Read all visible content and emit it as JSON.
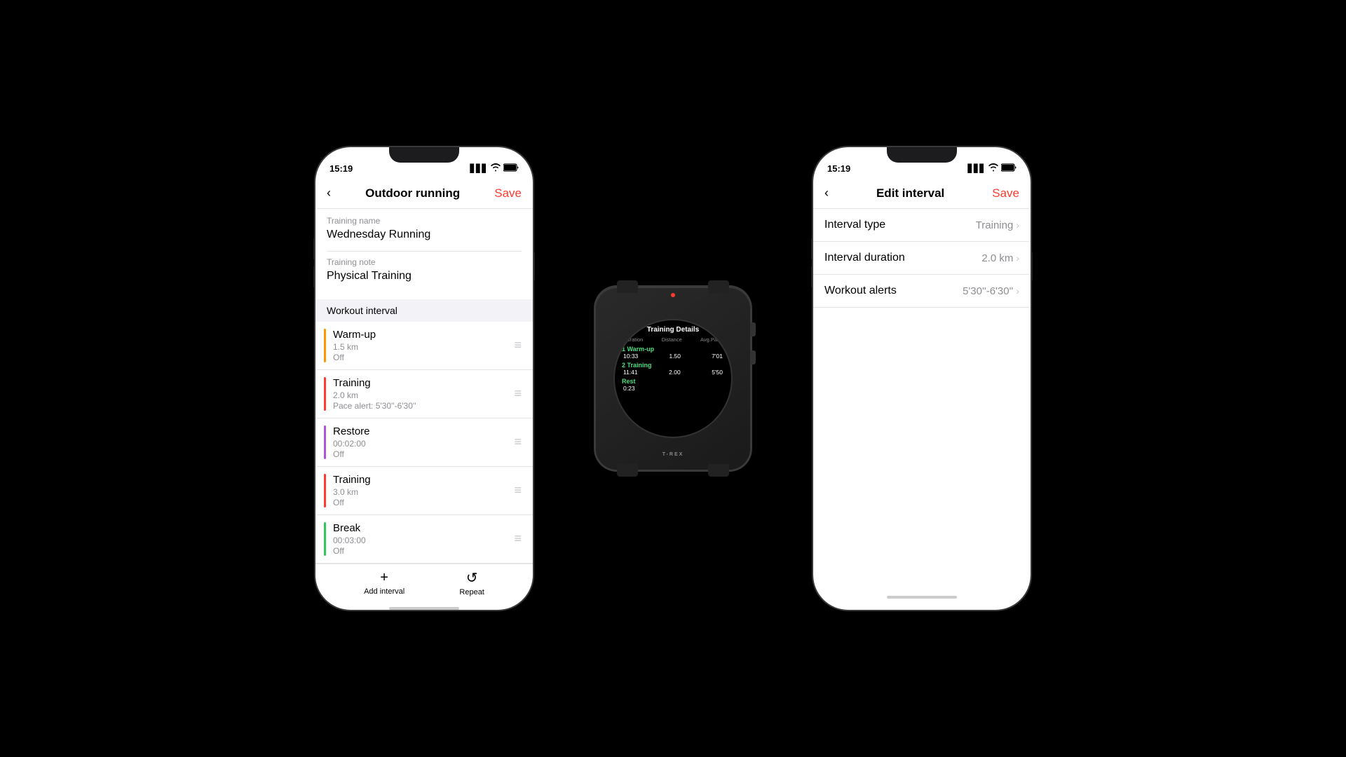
{
  "left_phone": {
    "status": {
      "time": "15:19",
      "time_icon": "◀",
      "signal": "▋▋▋",
      "wifi": "WiFi",
      "battery": "🔋"
    },
    "nav": {
      "back": "‹",
      "title": "Outdoor running",
      "save": "Save"
    },
    "form": {
      "name_label": "Training name",
      "name_value": "Wednesday Running",
      "note_label": "Training note",
      "note_value": "Physical Training"
    },
    "section": {
      "label": "Workout interval"
    },
    "intervals": [
      {
        "type": "warmup",
        "name": "Warm-up",
        "detail1": "1.5 km",
        "detail2": "Off",
        "bar_color": "#ff9500"
      },
      {
        "type": "training",
        "name": "Training",
        "detail1": "2.0 km",
        "detail2": "Pace alert: 5'30''-6'30''",
        "bar_color": "#ff3b30"
      },
      {
        "type": "restore",
        "name": "Restore",
        "detail1": "00:02:00",
        "detail2": "Off",
        "bar_color": "#af52de"
      },
      {
        "type": "training2",
        "name": "Training",
        "detail1": "3.0 km",
        "detail2": "Off",
        "bar_color": "#ff3b30"
      },
      {
        "type": "break",
        "name": "Break",
        "detail1": "00:03:00",
        "detail2": "Off",
        "bar_color": "#34c759"
      }
    ],
    "bottom": {
      "add_label": "Add interval",
      "repeat_label": "Repeat"
    }
  },
  "right_phone": {
    "status": {
      "time": "15:19",
      "signal": "▋▋▋",
      "wifi": "WiFi",
      "battery": "🔋"
    },
    "nav": {
      "back": "‹",
      "title": "Edit interval",
      "save": "Save"
    },
    "rows": [
      {
        "label": "Interval type",
        "value": "Training",
        "has_chevron": true
      },
      {
        "label": "Interval duration",
        "value": "2.0 km",
        "has_chevron": true
      },
      {
        "label": "Workout alerts",
        "value": "5'30''-6'30''",
        "has_chevron": true
      }
    ]
  },
  "watch": {
    "title": "Training Details",
    "header": {
      "col1": "Duration",
      "col2": "Distance",
      "col3": "Avg.Pace"
    },
    "entries": [
      {
        "name": "1 Warm-up",
        "duration": "10:33",
        "distance": "1.50",
        "pace": "7'01"
      },
      {
        "name": "2 Training",
        "duration": "11:41",
        "distance": "2.00",
        "pace": "5'50"
      },
      {
        "name": "Rest",
        "duration": "0:23",
        "distance": "",
        "pace": ""
      }
    ],
    "brand": "T-REX"
  }
}
